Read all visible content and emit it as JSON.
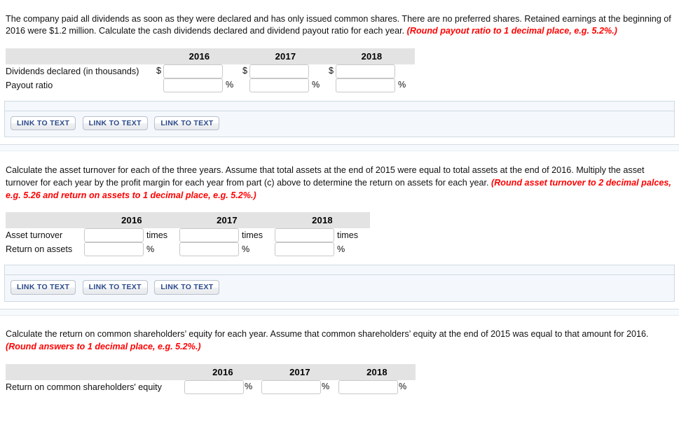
{
  "sections": [
    {
      "id": "dividends",
      "prompt_plain": "The company paid all dividends as soon as they were declared and has only issued common shares. There are no preferred shares. Retained earnings at the beginning of 2016 were $1.2 million. Calculate the cash dividends declared and dividend payout ratio for each year. ",
      "prompt_hint": "(Round payout ratio to 1 decimal place, e.g. 5.2%.)",
      "table": {
        "corner_label": "",
        "columns": [
          "2016",
          "2017",
          "2018"
        ],
        "rows": [
          {
            "label": "Dividends declared (in thousands)",
            "prefix": "$",
            "suffix": "",
            "values": [
              "",
              "",
              ""
            ]
          },
          {
            "label": "Payout ratio",
            "prefix": "",
            "suffix": "%",
            "values": [
              "",
              "",
              ""
            ]
          }
        ]
      },
      "link_buttons": [
        "LINK TO TEXT",
        "LINK TO TEXT",
        "LINK TO TEXT"
      ]
    },
    {
      "id": "asset-turnover",
      "prompt_plain": "Calculate the asset turnover for each of the three years. Assume that total assets at the end of 2015 were equal to total assets at the end of 2016. Multiply the asset turnover for each year by the profit margin for each year from part (c) above to determine the return on assets for each year. ",
      "prompt_hint": "(Round asset turnover to 2 decimal palces, e.g. 5.26 and return on assets to 1 decimal place, e.g. 5.2%.)",
      "table": {
        "corner_label": "",
        "columns": [
          "2016",
          "2017",
          "2018"
        ],
        "rows": [
          {
            "label": "Asset turnover",
            "prefix": "",
            "suffix": "times",
            "values": [
              "",
              "",
              ""
            ]
          },
          {
            "label": "Return on assets",
            "prefix": "",
            "suffix": "%",
            "values": [
              "",
              "",
              ""
            ]
          }
        ]
      },
      "link_buttons": [
        "LINK TO TEXT",
        "LINK TO TEXT",
        "LINK TO TEXT"
      ]
    },
    {
      "id": "return-on-equity",
      "prompt_plain": "Calculate the return on common shareholders’ equity for each year. Assume that common shareholders’ equity at the end of 2015 was equal to that amount for 2016. ",
      "prompt_hint": "(Round answers to 1 decimal place, e.g. 5.2%.)",
      "table": {
        "corner_label": "",
        "columns": [
          "2016",
          "2017",
          "2018"
        ],
        "rows": [
          {
            "label": "Return on common shareholders' equity",
            "prefix": "",
            "suffix": "%",
            "values": [
              "",
              "",
              ""
            ]
          }
        ]
      },
      "link_buttons": []
    }
  ],
  "colors": {
    "hint_red": "#FF0000",
    "header_gray": "#e3e3e3",
    "panel_blue": "#f4f8fc",
    "button_text": "#2b4a8b"
  }
}
